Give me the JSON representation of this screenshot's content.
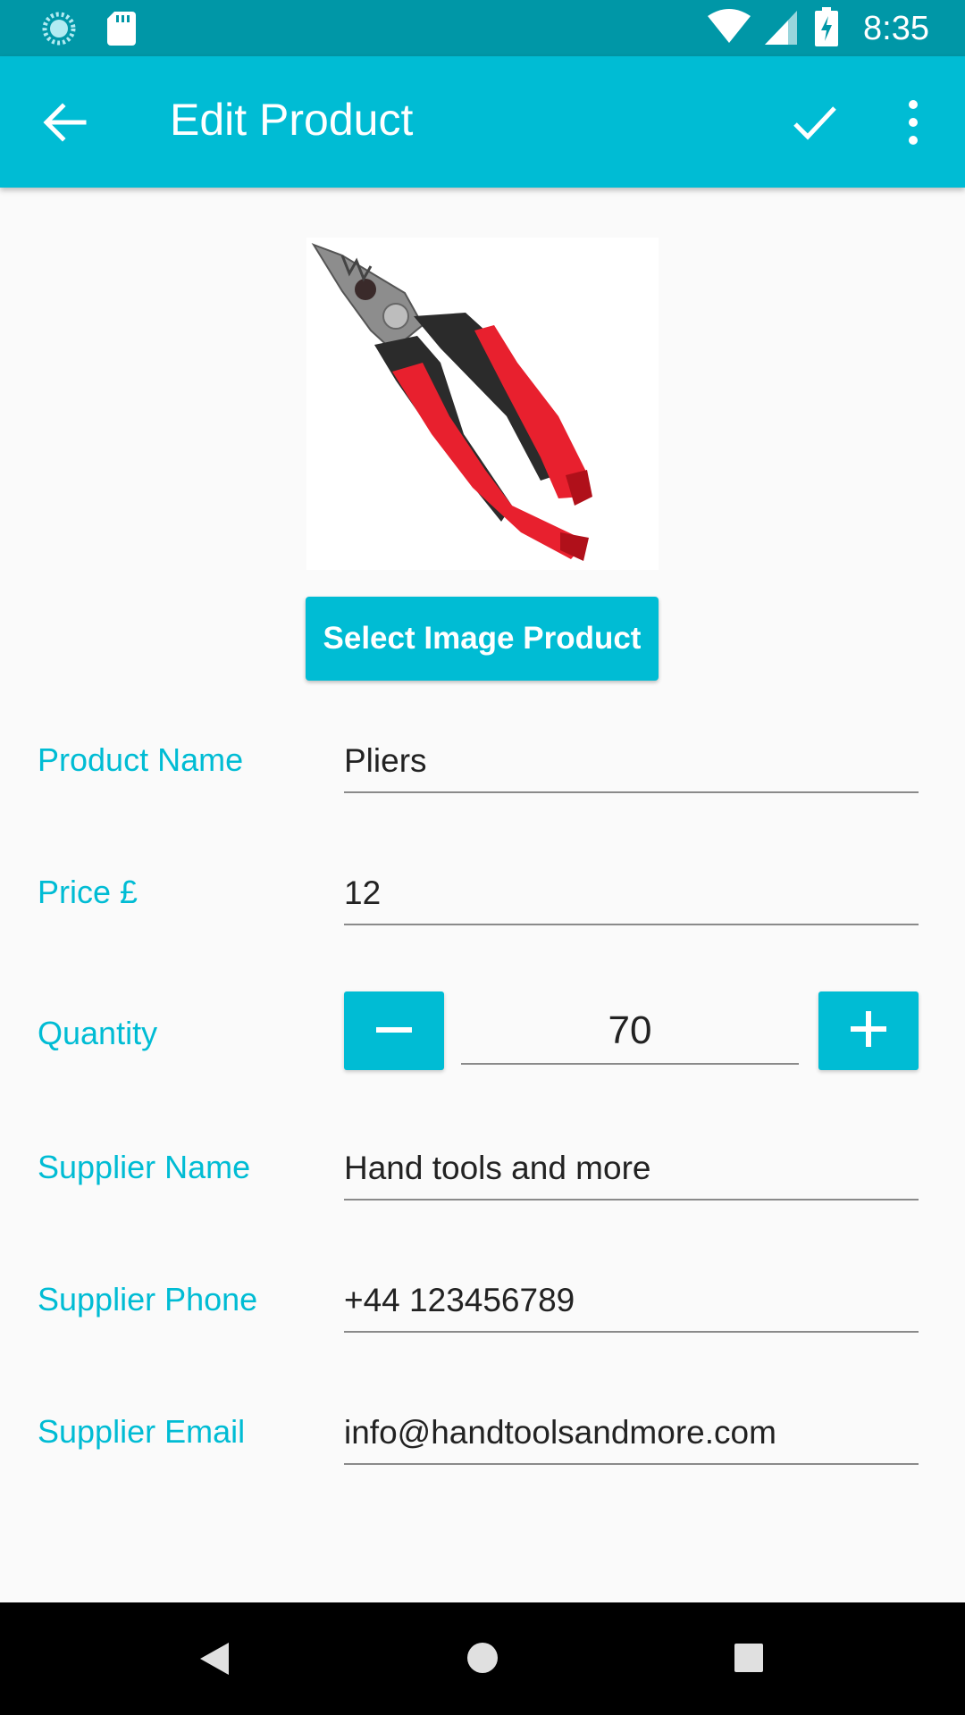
{
  "status_bar": {
    "time": "8:35",
    "icons": [
      "sync-icon",
      "sd-card-icon",
      "wifi-icon",
      "signal-icon",
      "battery-charging-icon"
    ]
  },
  "app_bar": {
    "title": "Edit Product",
    "icons": [
      "back-arrow-icon",
      "check-icon",
      "more-vert-icon"
    ]
  },
  "product": {
    "image": "pliers-image",
    "select_image_label": "Select Image Product"
  },
  "form": {
    "product_name": {
      "label": "Product Name",
      "value": "Pliers"
    },
    "price": {
      "label": "Price £",
      "value": "12"
    },
    "quantity": {
      "label": "Quantity",
      "value": "70"
    },
    "supplier_name": {
      "label": "Supplier Name",
      "value": "Hand tools and more"
    },
    "supplier_phone": {
      "label": "Supplier Phone",
      "value": "+44 123456789"
    },
    "supplier_email": {
      "label": "Supplier Email",
      "value": "info@handtoolsandmore.com"
    }
  },
  "colors": {
    "primary": "#00bcd4",
    "primary_dark": "#0097a7",
    "background": "#fafafa"
  }
}
